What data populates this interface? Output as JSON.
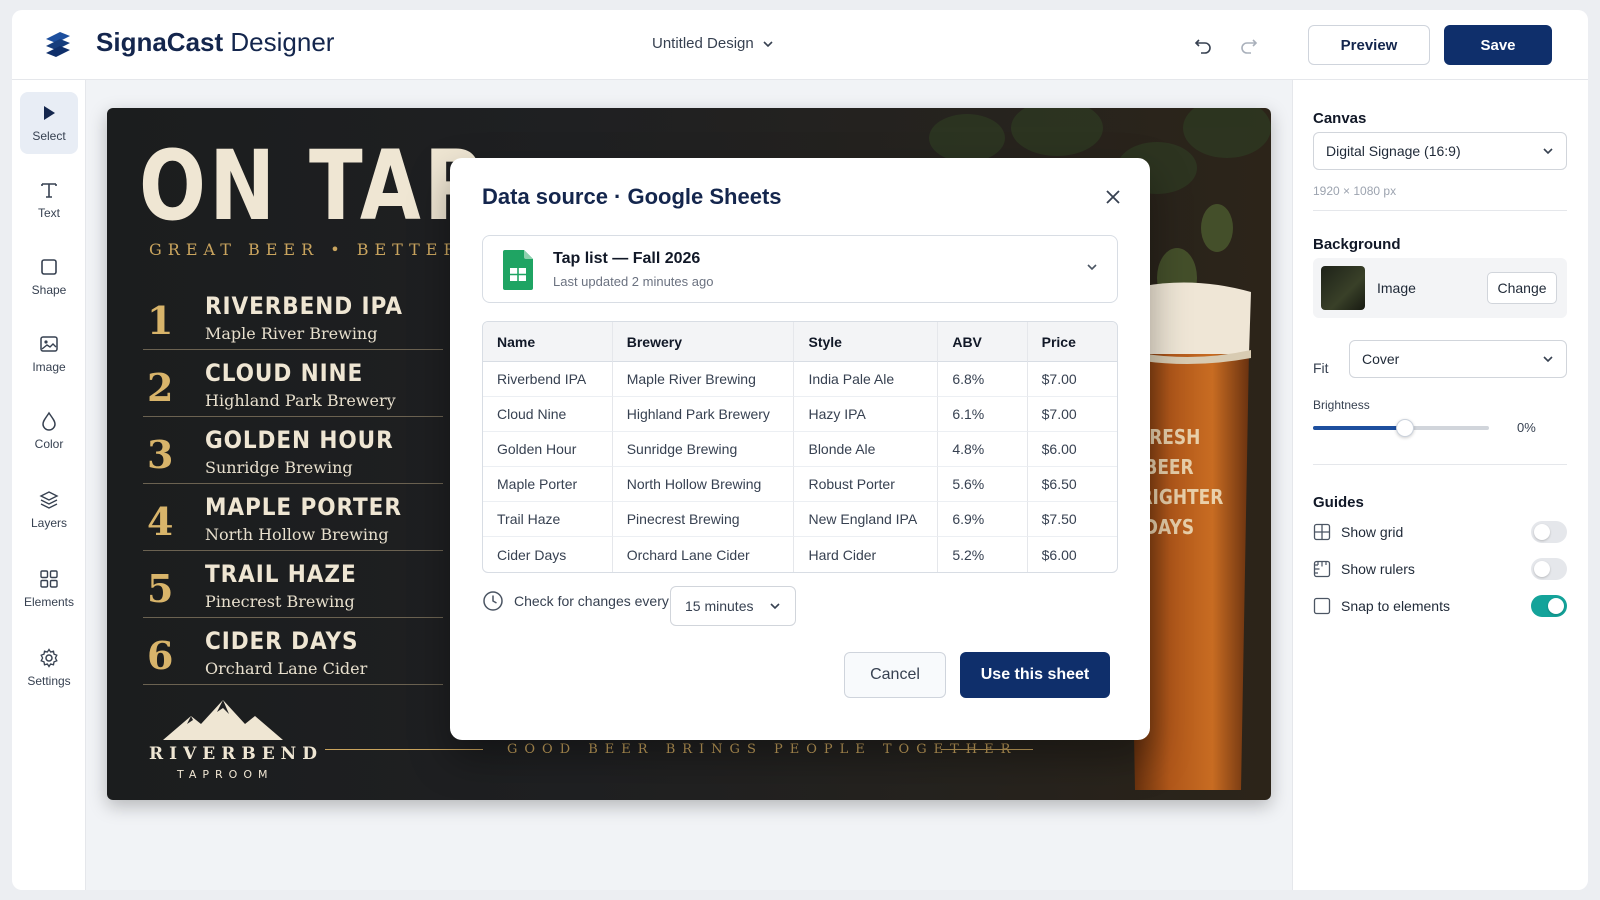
{
  "header": {
    "brand_bold": "SignaCast",
    "brand_light": " Designer",
    "document_title": "Untitled Design",
    "preview_label": "Preview",
    "save_label": "Save"
  },
  "toolbar": {
    "items": [
      {
        "label": "Select",
        "icon": "cursor-icon"
      },
      {
        "label": "Text",
        "icon": "text-icon"
      },
      {
        "label": "Shape",
        "icon": "square-icon"
      },
      {
        "label": "Image",
        "icon": "image-icon"
      },
      {
        "label": "Color",
        "icon": "droplet-icon"
      },
      {
        "label": "Layers",
        "icon": "layers-icon"
      },
      {
        "label": "Elements",
        "icon": "grid-icon"
      },
      {
        "label": "Settings",
        "icon": "gear-icon"
      }
    ]
  },
  "signage": {
    "headline": "ON TAP",
    "tagline": "GREAT BEER • BETTER",
    "beers": [
      {
        "num": "1",
        "name": "RIVERBEND IPA",
        "brewery": "Maple River Brewing"
      },
      {
        "num": "2",
        "name": "CLOUD NINE",
        "brewery": "Highland Park Brewery"
      },
      {
        "num": "3",
        "name": "GOLDEN HOUR",
        "brewery": "Sunridge Brewing"
      },
      {
        "num": "4",
        "name": "MAPLE PORTER",
        "brewery": "North Hollow Brewing"
      },
      {
        "num": "5",
        "name": "TRAIL HAZE",
        "brewery": "Pinecrest Brewing"
      },
      {
        "num": "6",
        "name": "CIDER DAYS",
        "brewery": "Orchard Lane Cider"
      }
    ],
    "logo_name": "RIVERBEND",
    "logo_sub": "TAPROOM",
    "footer": "GOOD BEER BRINGS PEOPLE TOGETHER",
    "glass_text": [
      "FRESH",
      "BEER",
      "BRIGHTER",
      "DAYS"
    ]
  },
  "right_panel": {
    "canvas_heading": "Canvas",
    "canvas_preset": "Digital Signage (16:9)",
    "canvas_size": "1920 × 1080 px",
    "background_heading": "Background",
    "background_type": "Image",
    "change_label": "Change",
    "fit_label": "Fit",
    "fit_value": "Cover",
    "brightness_label": "Brightness",
    "brightness_value": "0%",
    "brightness_slider_fraction": 0.52,
    "guides_heading": "Guides",
    "guides": [
      {
        "label": "Show grid",
        "on": false
      },
      {
        "label": "Show rulers",
        "on": false
      },
      {
        "label": "Snap to elements",
        "on": true
      }
    ]
  },
  "modal": {
    "title": "Data source · Google Sheets",
    "sheet_name": "Tap list — Fall 2026",
    "sheet_updated": "Last updated 2 minutes ago",
    "columns": [
      "Name",
      "Brewery",
      "Style",
      "ABV",
      "Price"
    ],
    "rows": [
      [
        "Riverbend IPA",
        "Maple River Brewing",
        "India Pale Ale",
        "6.8%",
        "$7.00"
      ],
      [
        "Cloud Nine",
        "Highland Park Brewery",
        "Hazy IPA",
        "6.1%",
        "$7.00"
      ],
      [
        "Golden Hour",
        "Sunridge Brewing",
        "Blonde Ale",
        "4.8%",
        "$6.00"
      ],
      [
        "Maple Porter",
        "North Hollow Brewing",
        "Robust Porter",
        "5.6%",
        "$6.50"
      ],
      [
        "Trail Haze",
        "Pinecrest Brewing",
        "New England IPA",
        "6.9%",
        "$7.50"
      ],
      [
        "Cider Days",
        "Orchard Lane Cider",
        "Hard Cider",
        "5.2%",
        "$6.00"
      ]
    ],
    "check_label": "Check for changes every",
    "interval_value": "15 minutes",
    "cancel_label": "Cancel",
    "confirm_label": "Use this sheet"
  },
  "colors": {
    "primary": "#0f2f6b",
    "toggle_on": "#14a39a",
    "sheets_green": "#1fa463",
    "gold": "#c9a45e"
  }
}
